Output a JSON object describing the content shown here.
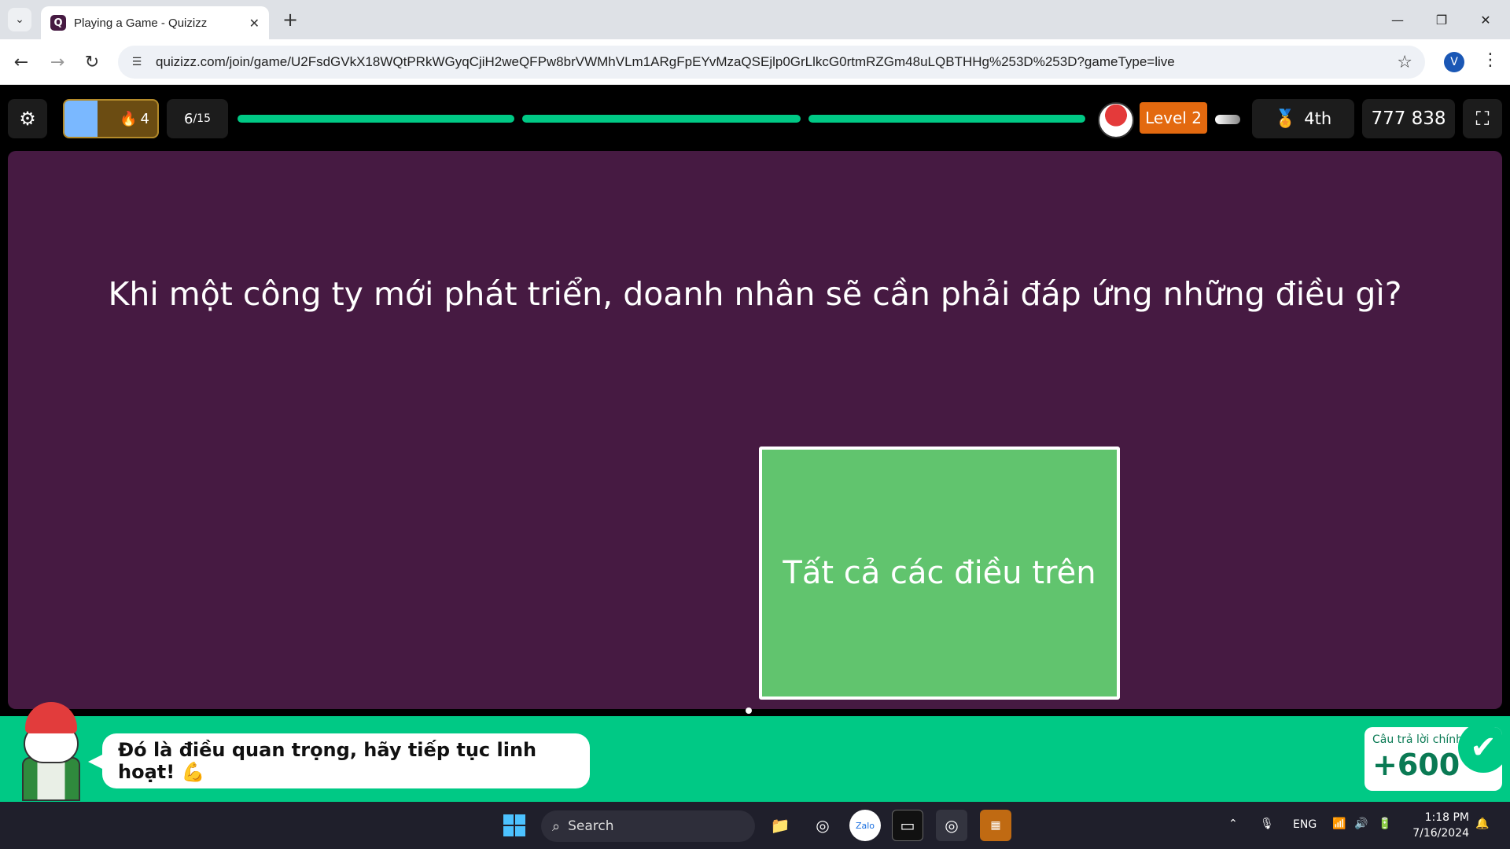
{
  "browser": {
    "tab_title": "Playing a Game - Quizizz",
    "tab_icon": "quizizz-favicon",
    "url": "quizizz.com/join/game/U2FsdGVkX18WQtPRkWGyqCjiH2weQFPw8brVWMhVLm1ARgFpEYvMzaQSEjlp0GrLlkcG0rtmRZGm48uLQBTHHg%253D%253D?gameType=live",
    "profile_initial": "V"
  },
  "hud": {
    "streak_count": "4",
    "question_current": "6",
    "question_total": "/15",
    "progress_segments": [
      1,
      1,
      1
    ],
    "level": "Level 2",
    "rank": "4th",
    "score": "777 838"
  },
  "question": {
    "text": "Khi một công ty mới phát triển, doanh nhân sẽ cần phải đáp ứng những điều gì?",
    "answer": "Tất cả các điều trên"
  },
  "feedback": {
    "message": "Đó là điều quan trọng, hãy tiếp tục linh hoạt! 💪",
    "correct_label": "Câu trả lời chính",
    "points": "+600"
  },
  "taskbar": {
    "search_placeholder": "Search",
    "language": "ENG",
    "time": "1:18 PM",
    "date": "7/16/2024"
  },
  "colors": {
    "panel": "#461a42",
    "answer": "#61c46e",
    "feedback": "#00c985",
    "level": "#e3690f"
  }
}
